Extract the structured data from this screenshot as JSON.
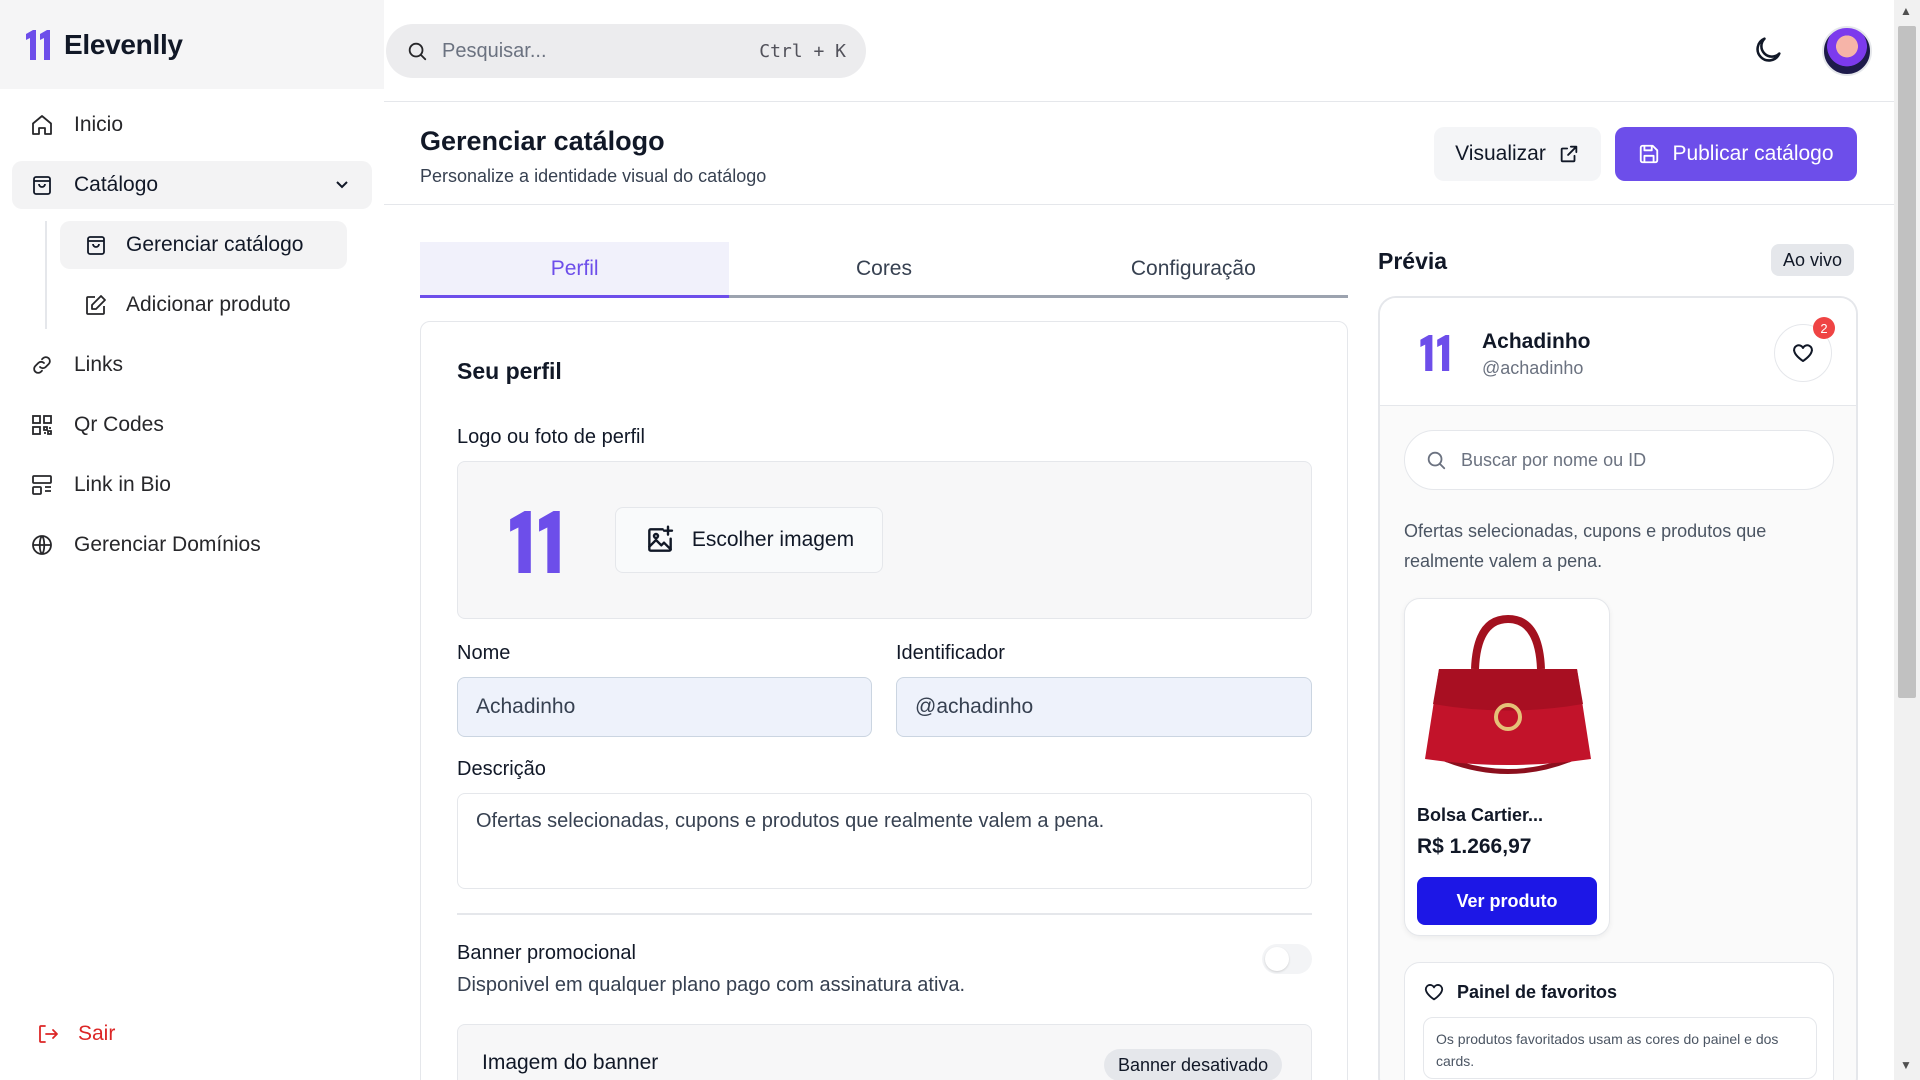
{
  "brand": {
    "name": "Elevenlly",
    "accent": "#6d4eea"
  },
  "sidebar": {
    "items": [
      {
        "label": "Inicio",
        "icon": "home-icon"
      },
      {
        "label": "Catálogo",
        "icon": "bag-icon"
      },
      {
        "label": "Links",
        "icon": "link-icon"
      },
      {
        "label": "Qr Codes",
        "icon": "qr-icon"
      },
      {
        "label": "Link in Bio",
        "icon": "layout-icon"
      },
      {
        "label": "Gerenciar Domínios",
        "icon": "globe-icon"
      }
    ],
    "subitems": [
      {
        "label": "Gerenciar catálogo",
        "icon": "bag-icon"
      },
      {
        "label": "Adicionar produto",
        "icon": "edit-icon"
      }
    ],
    "logout": "Sair"
  },
  "topbar": {
    "search_placeholder": "Pesquisar...",
    "shortcut": "Ctrl + K"
  },
  "header": {
    "title": "Gerenciar catálogo",
    "subtitle": "Personalize a identidade visual do catálogo",
    "view_label": "Visualizar",
    "publish_label": "Publicar catálogo"
  },
  "tabs": [
    "Perfil",
    "Cores",
    "Configuração"
  ],
  "profile": {
    "title": "Seu perfil",
    "logo_label": "Logo ou foto de perfil",
    "choose_image": "Escolher imagem",
    "name_label": "Nome",
    "name_value": "Achadinho",
    "id_label": "Identificador",
    "id_value": "@achadinho",
    "desc_label": "Descrição",
    "desc_value": "Ofertas selecionadas, cupons e produtos que realmente valem a pena.",
    "banner_title": "Banner promocional",
    "banner_sub": "Disponivel em qualquer plano pago com assinatura ativa.",
    "banner_enabled": false,
    "banner_image_label": "Imagem do banner",
    "banner_badge": "Banner desativado"
  },
  "preview": {
    "title": "Prévia",
    "live": "Ao vivo",
    "name": "Achadinho",
    "handle": "@achadinho",
    "fav_count": "2",
    "search_placeholder": "Buscar por nome ou ID",
    "description": "Ofertas selecionadas, cupons e produtos que realmente valem a pena.",
    "product": {
      "name": "Bolsa Cartier...",
      "price": "R$ 1.266,97",
      "button": "Ver produto"
    },
    "fav_panel_title": "Painel de favoritos",
    "fav_panel_note": "Os produtos favoritados usam as cores do painel e dos cards."
  }
}
